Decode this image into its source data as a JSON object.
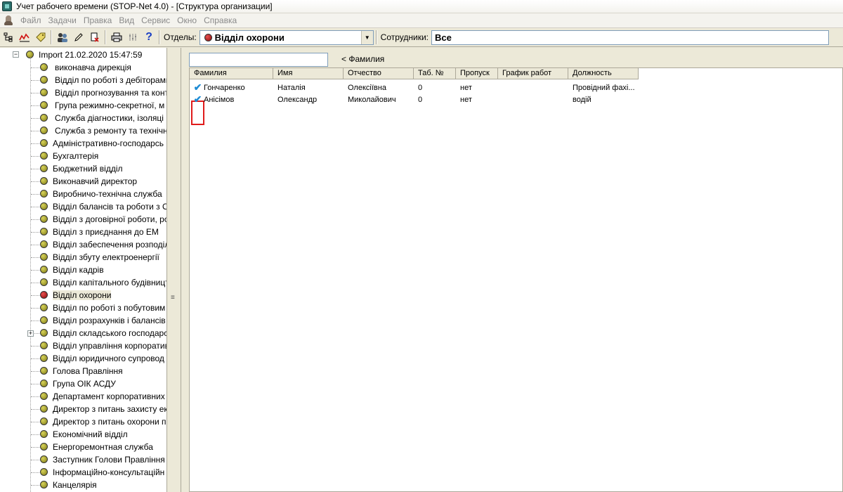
{
  "window": {
    "title": "Учет рабочего времени (STOP-Net 4.0) - [Структура организации]"
  },
  "menu": [
    "Файл",
    "Задачи",
    "Правка",
    "Вид",
    "Сервис",
    "Окно",
    "Справка"
  ],
  "toolbar": {
    "icons": [
      "structure-icon",
      "chart-icon",
      "tag-icon",
      "users-icon",
      "pencil-icon",
      "delete-doc-icon",
      "print-icon",
      "settings-icon",
      "help-icon"
    ],
    "help_glyph": "?",
    "departments_label": "Отделы:",
    "departments_value": "Відділ охорони",
    "employees_label": "Сотрудники:",
    "employees_value": "Все"
  },
  "tree": {
    "root": "Import 21.02.2020 15:47:59",
    "items": [
      {
        "label": "виконавча дирекція"
      },
      {
        "label": "Відділ по роботі з дебіторами"
      },
      {
        "label": "Відділ прогнозування та конт"
      },
      {
        "label": "Група режимно-секретної, м"
      },
      {
        "label": "Служба діагностики, ізоляці"
      },
      {
        "label": "Служба з ремонту та технічн"
      },
      {
        "label": "Адміністративно-господарсь"
      },
      {
        "label": "Бухгалтерія"
      },
      {
        "label": "Бюджетний відділ"
      },
      {
        "label": "Виконавчий директор"
      },
      {
        "label": "Виробничо-технічна служба"
      },
      {
        "label": "Відділ балансів та роботи з О"
      },
      {
        "label": "Відділ з договірної роботи, ро"
      },
      {
        "label": "Відділ з приєднання до ЕМ"
      },
      {
        "label": "Відділ забеспечення розподіл"
      },
      {
        "label": "Відділ збуту електроенергії"
      },
      {
        "label": "Відділ кадрів"
      },
      {
        "label": "Відділ капітального будівницт"
      },
      {
        "label": "Відділ охорони",
        "selected": true
      },
      {
        "label": "Відділ по роботі з побутовим"
      },
      {
        "label": "Відділ розрахунків і балансів"
      },
      {
        "label": "Відділ складського господарс",
        "expandable": true
      },
      {
        "label": "Відділ управління корпоратив"
      },
      {
        "label": "Відділ юридичного супровод"
      },
      {
        "label": "Голова Правління"
      },
      {
        "label": "Група ОІК АСДУ"
      },
      {
        "label": "Департамент корпоративних"
      },
      {
        "label": "Директор з питань захисту ек"
      },
      {
        "label": "Директор з питань охорони п"
      },
      {
        "label": "Економічний відділ"
      },
      {
        "label": "Енергоремонтная служба"
      },
      {
        "label": "Заступник Голови Правління"
      },
      {
        "label": "Інформаційно-консультаційн"
      },
      {
        "label": "Канцелярія"
      }
    ]
  },
  "search": {
    "value": "",
    "hint": "< Фамилия"
  },
  "grid": {
    "columns": [
      "Фамилия",
      "Имя",
      "Отчество",
      "Таб. №",
      "Пропуск",
      "График работ",
      "Должность"
    ],
    "rows": [
      {
        "cells": [
          "Гончаренко",
          "Наталія",
          "Олексіївна",
          "0",
          "нет",
          "",
          "Провідний фахі..."
        ],
        "checked": true
      },
      {
        "cells": [
          "Анісімов",
          "Олександр",
          "Миколайович",
          "0",
          "нет",
          "",
          "водій"
        ],
        "checked": true
      }
    ]
  }
}
